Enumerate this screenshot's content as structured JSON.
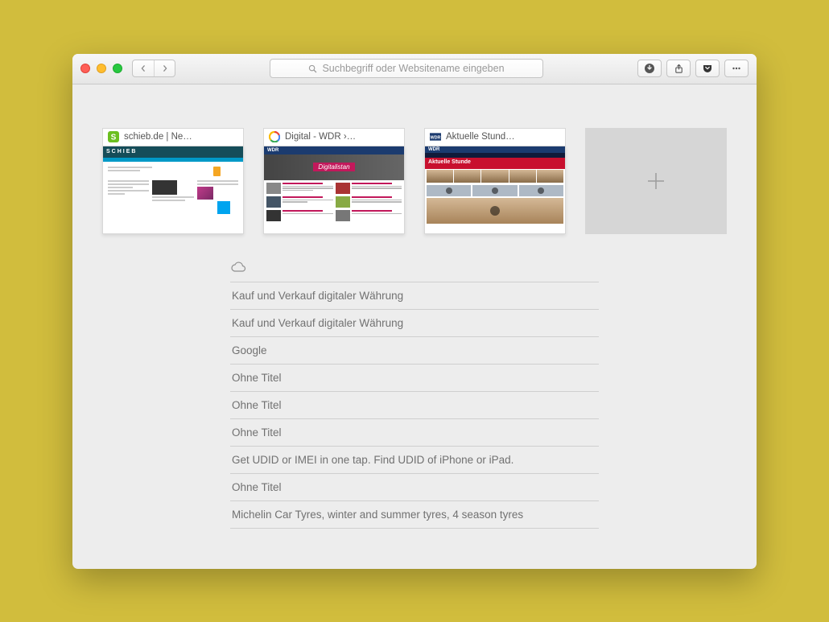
{
  "toolbar": {
    "address_placeholder": "Suchbegriff oder Websitename eingeben"
  },
  "favorites": [
    {
      "title": "schieb.de | Ne…",
      "icon": "schieb"
    },
    {
      "title": "Digital - WDR ›…",
      "icon": "google"
    },
    {
      "title": "Aktuelle Stund…",
      "icon": "wdr"
    }
  ],
  "reading_list": [
    "Kauf und Verkauf digitaler Währung",
    "Kauf und Verkauf digitaler Währung",
    "Google",
    "Ohne Titel",
    "Ohne Titel",
    "Ohne Titel",
    "Get UDID or IMEI in one tap. Find UDID of iPhone or iPad.",
    "Ohne Titel",
    "Michelin Car Tyres, winter and summer tyres, 4 season tyres"
  ],
  "thumb2_hero": "Digitalistan",
  "thumb3_banner": "Aktuelle Stunde",
  "thumb3_wdr": "WDR"
}
